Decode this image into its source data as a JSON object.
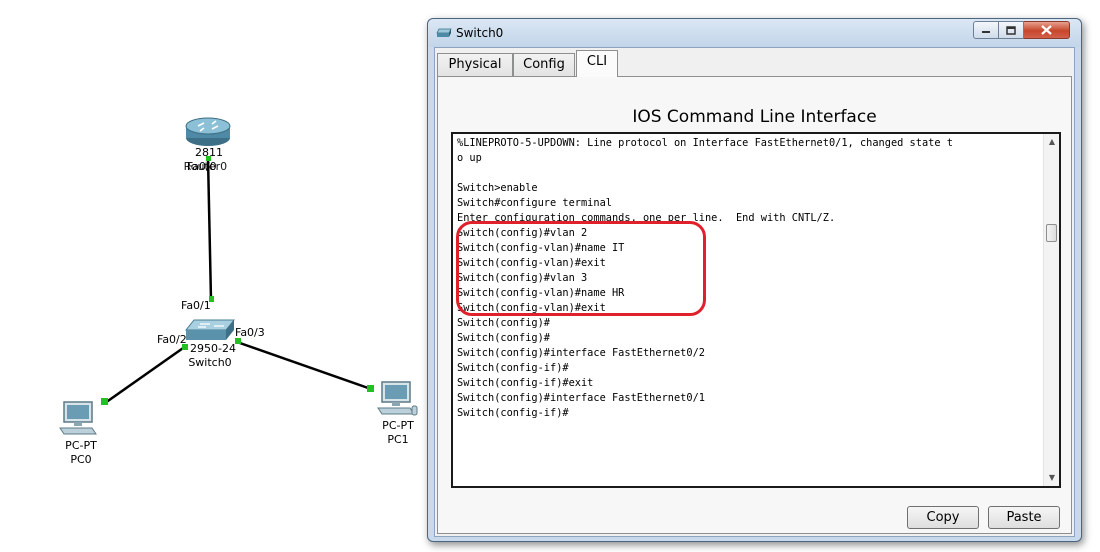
{
  "topology": {
    "router": {
      "model": "2811",
      "name": "Router0"
    },
    "switch": {
      "model": "2950-24",
      "name": "Switch0"
    },
    "pc0": {
      "model": "PC-PT",
      "name": "PC0"
    },
    "pc1": {
      "model": "PC-PT",
      "name": "PC1"
    },
    "ports": {
      "router_fa00": "Fa0/0",
      "switch_fa01": "Fa0/1",
      "switch_fa02": "Fa0/2",
      "switch_fa03": "Fa0/3"
    },
    "colors": {
      "link": "#000000",
      "link_up": "#22c022"
    }
  },
  "window": {
    "title": "Switch0",
    "icon": "switch-icon",
    "tabs": [
      {
        "label": "Physical",
        "active": false
      },
      {
        "label": "Config",
        "active": false
      },
      {
        "label": "CLI",
        "active": true
      }
    ],
    "heading": "IOS Command Line Interface",
    "console_lines": [
      "%LINEPROTO-5-UPDOWN: Line protocol on Interface FastEthernet0/1, changed state t",
      "o up",
      "",
      "Switch>enable",
      "Switch#configure terminal",
      "Enter configuration commands, one per line.  End with CNTL/Z.",
      "Switch(config)#vlan 2",
      "Switch(config-vlan)#name IT",
      "Switch(config-vlan)#exit",
      "Switch(config)#vlan 3",
      "Switch(config-vlan)#name HR",
      "Switch(config-vlan)#exit",
      "Switch(config)#",
      "Switch(config)#",
      "Switch(config)#interface FastEthernet0/2",
      "Switch(config-if)#",
      "Switch(config-if)#exit",
      "Switch(config)#interface FastEthernet0/1",
      "Switch(config-if)#"
    ],
    "highlight_color": "#e0202a",
    "buttons": {
      "copy": "Copy",
      "paste": "Paste"
    }
  }
}
